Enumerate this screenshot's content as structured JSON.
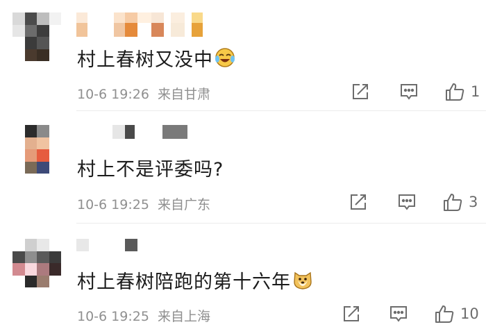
{
  "comments": [
    {
      "text": "村上春树又没中",
      "emoji": "laughing-crying-emoji",
      "date": "10-6",
      "time": "19:26",
      "location": "来自甘肃",
      "likes": "1"
    },
    {
      "text": "村上不是评委吗?",
      "emoji": "",
      "date": "10-6",
      "time": "19:25",
      "location": "来自广东",
      "likes": "3"
    },
    {
      "text": "村上春树陪跑的第十六年",
      "emoji": "doge-emoji",
      "date": "10-6",
      "time": "19:25",
      "location": "来自上海",
      "likes": "10"
    }
  ],
  "icons": {
    "share": "share-icon",
    "reply": "comment-icon",
    "like": "thumbs-up-icon"
  },
  "colors": {
    "text": "#1b1b1b",
    "meta": "#8f8f8f",
    "icon": "#6c6c6c",
    "divider": "#ececec"
  }
}
